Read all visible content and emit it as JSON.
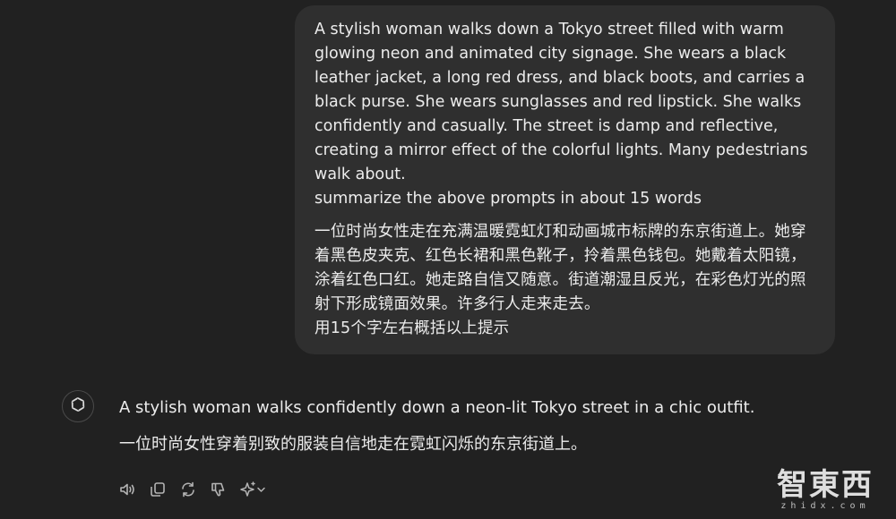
{
  "user_message": {
    "english_prompt": "A stylish woman walks down a Tokyo street filled with warm\nglowing neon and animated city signage. She wears a black\nleather jacket, a long red dress, and black boots, and carries a\nblack purse. She wears sunglasses and red lipstick. She walks\nconfidently and casually. The street is damp and reflective,\ncreating a mirror effect of the colorful lights. Many pedestrians\nwalk about.\nsummarize the above prompts in about 15 words",
    "chinese_prompt": "一位时尚女性走在充满温暖霓虹灯和动画城市标牌的东京街道上。她穿\n着黑色皮夹克、红色长裙和黑色靴子，拎着黑色钱包。她戴着太阳镜，\n涂着红色口红。她走路自信又随意。街道潮湿且反光，在彩色灯光的照\n射下形成镜面效果。许多行人走来走去。\n用15个字左右概括以上提示"
  },
  "assistant_message": {
    "english_reply": "A stylish woman walks confidently down a neon-lit Tokyo street in a chic outfit.",
    "chinese_reply": "一位时尚女性穿着别致的服装自信地走在霓虹闪烁的东京街道上。"
  },
  "actions": {
    "icons": [
      "read-aloud-icon",
      "copy-icon",
      "regenerate-icon",
      "thumbs-down-icon",
      "change-model-icon"
    ]
  },
  "watermark": {
    "logo_text": "智東西",
    "sub_text": "zhidx.com"
  }
}
